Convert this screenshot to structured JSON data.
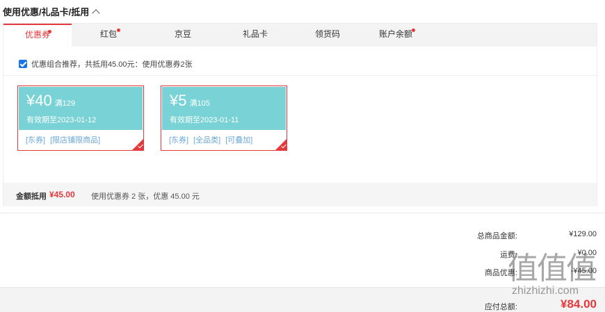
{
  "section": {
    "title": "使用优惠/礼品卡/抵用"
  },
  "tabs": [
    {
      "label": "优惠券",
      "active": true,
      "dot": true
    },
    {
      "label": "红包",
      "active": false,
      "dot": true
    },
    {
      "label": "京豆",
      "active": false,
      "dot": false
    },
    {
      "label": "礼品卡",
      "active": false,
      "dot": false
    },
    {
      "label": "领货码",
      "active": false,
      "dot": false
    },
    {
      "label": "账户余额",
      "active": false,
      "dot": true
    }
  ],
  "combo": {
    "checked": true,
    "text": "优惠组合推荐，共抵用45.00元：使用优惠券2张"
  },
  "coupons": [
    {
      "amount": "¥40",
      "condition": "满129",
      "valid": "有效期至2023-01-12",
      "tags": [
        "[东券]",
        "[限店铺限商品]"
      ]
    },
    {
      "amount": "¥5",
      "condition": "满105",
      "valid": "有效期至2023-01-11",
      "tags": [
        "[东券]",
        "[全品类]",
        "[可叠加]"
      ]
    }
  ],
  "summary": {
    "label": "金额抵用",
    "value": "¥45.00",
    "desc": "使用优惠券 2 张，优惠 45.00 元"
  },
  "totals": [
    {
      "label": "总商品金额:",
      "value": "¥129.00"
    },
    {
      "label": "运费:",
      "value": "¥0.00"
    },
    {
      "label": "商品优惠:",
      "value": "-¥45.00"
    }
  ],
  "payable": {
    "label": "应付总额:",
    "value": "¥84.00"
  },
  "watermark": {
    "glyphs": "值值值",
    "text": "zhizhizhi.com"
  },
  "colors": {
    "accent": "#e4393c",
    "coupon": "#79d3d6",
    "tag": "#6aa8d8"
  }
}
